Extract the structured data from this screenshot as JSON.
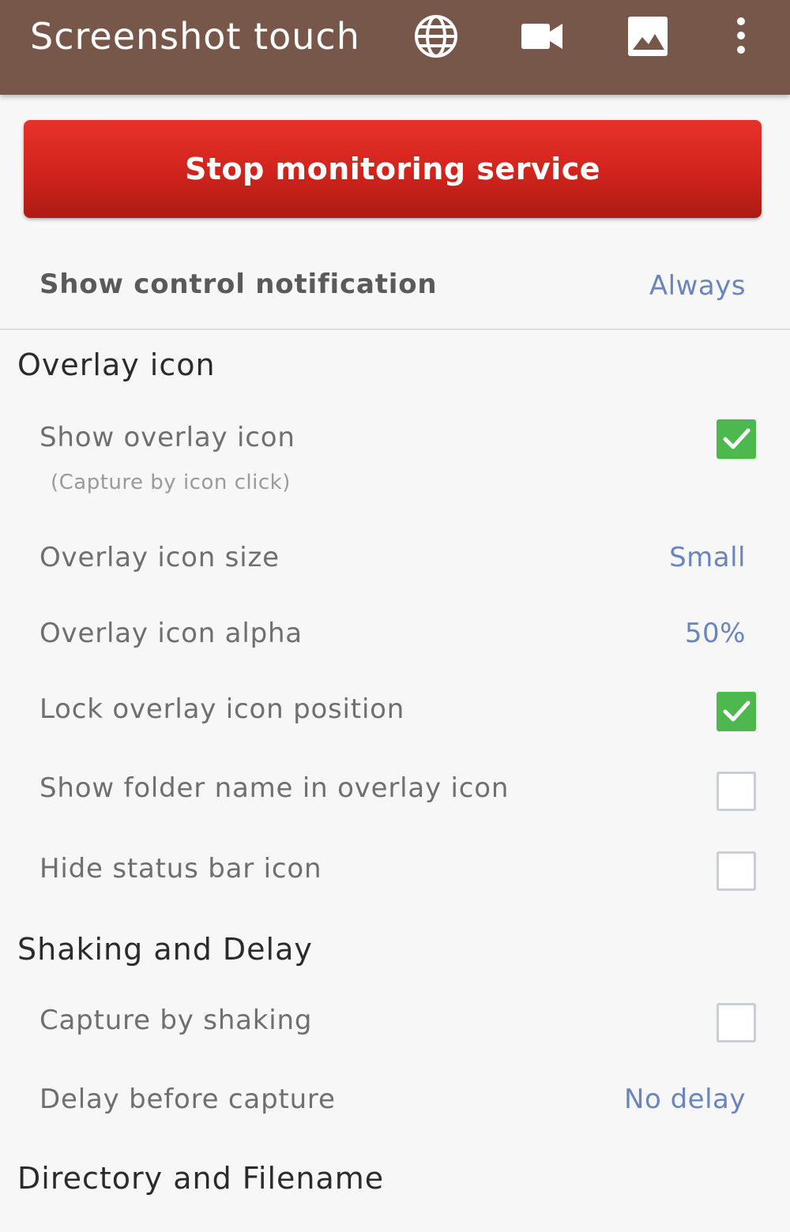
{
  "appbar": {
    "title": "Screenshot touch",
    "icons": [
      "globe-icon",
      "video-camera-icon",
      "image-icon",
      "more-vert-icon"
    ],
    "background_color": "#77574a"
  },
  "primary_button": {
    "label": "Stop monitoring service",
    "color": "#d0231c"
  },
  "control_notification": {
    "label": "Show control notification",
    "value": "Always"
  },
  "sections": [
    {
      "header": "Overlay icon",
      "items": [
        {
          "label": "Show overlay icon",
          "sublabel": "(Capture by icon click)",
          "checked": true
        },
        {
          "label": "Overlay icon size",
          "value": "Small"
        },
        {
          "label": "Overlay icon alpha",
          "value": "50%"
        },
        {
          "label": "Lock overlay icon position",
          "checked": true
        },
        {
          "label": "Show folder name in overlay icon",
          "checked": false
        },
        {
          "label": "Hide status bar icon",
          "checked": false
        }
      ]
    },
    {
      "header": "Shaking and Delay",
      "items": [
        {
          "label": "Capture by shaking",
          "checked": false
        },
        {
          "label": "Delay before capture",
          "value": "No delay"
        }
      ]
    },
    {
      "header": "Directory and Filename",
      "items": []
    }
  ],
  "colors": {
    "value_text": "#6a85be",
    "checkbox_checked": "#4cb84e",
    "checkbox_unchecked_border": "#c9cdd6"
  }
}
